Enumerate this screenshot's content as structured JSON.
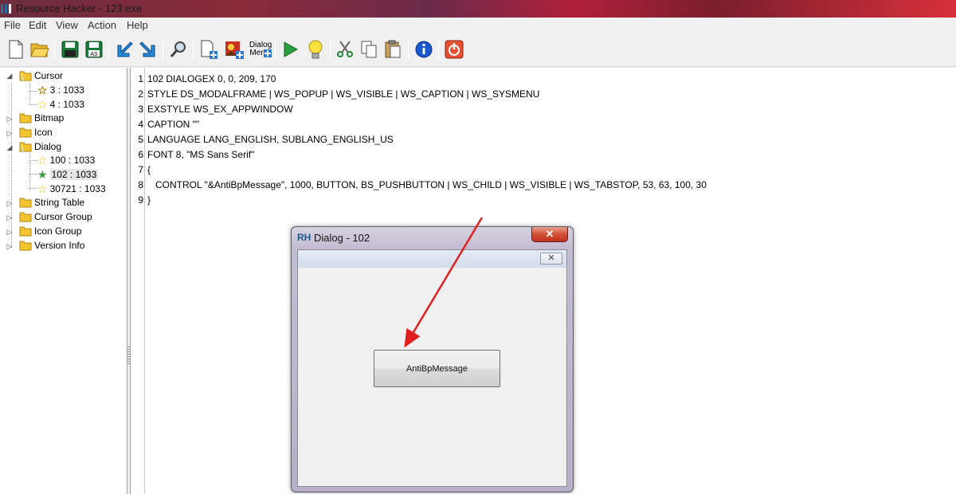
{
  "window": {
    "title": "Resource Hacker - 123.exe"
  },
  "menu": {
    "file": "File",
    "edit": "Edit",
    "view": "View",
    "action": "Action",
    "help": "Help"
  },
  "toolbar": {
    "dialog_menu_label_top": "Dialog",
    "dialog_menu_label_bottom": "Mer"
  },
  "tree": {
    "cursor": "Cursor",
    "cursor_3": "3 : 1033",
    "cursor_4": "4 : 1033",
    "bitmap": "Bitmap",
    "icon": "Icon",
    "dialog": "Dialog",
    "dialog_100": "100 : 1033",
    "dialog_102": "102 : 1033",
    "dialog_30721": "30721 : 1033",
    "string_table": "String Table",
    "cursor_group": "Cursor Group",
    "icon_group": "Icon Group",
    "version_info": "Version Info"
  },
  "editor": {
    "line_numbers": [
      "1",
      "2",
      "3",
      "4",
      "5",
      "6",
      "7",
      "8",
      "9"
    ],
    "lines": [
      "102 DIALOGEX 0, 0, 209, 170",
      "STYLE DS_MODALFRAME | WS_POPUP | WS_VISIBLE | WS_CAPTION | WS_SYSMENU",
      "EXSTYLE WS_EX_APPWINDOW",
      "CAPTION \"\"",
      "LANGUAGE LANG_ENGLISH, SUBLANG_ENGLISH_US",
      "FONT 8, \"MS Sans Serif\"",
      "{",
      "   CONTROL \"&AntiBpMessage\", 1000, BUTTON, BS_PUSHBUTTON | WS_CHILD | WS_VISIBLE | WS_TABSTOP, 53, 63, 100, 30",
      "}"
    ]
  },
  "preview_dialog": {
    "title_icon": "RH",
    "title": "Dialog -  102",
    "close_glyph": "✕",
    "inner_close_glyph": "✕",
    "button_label": "AntiBpMessage"
  },
  "colors": {
    "arrow": "#e02020",
    "folder": "#f4c430"
  }
}
